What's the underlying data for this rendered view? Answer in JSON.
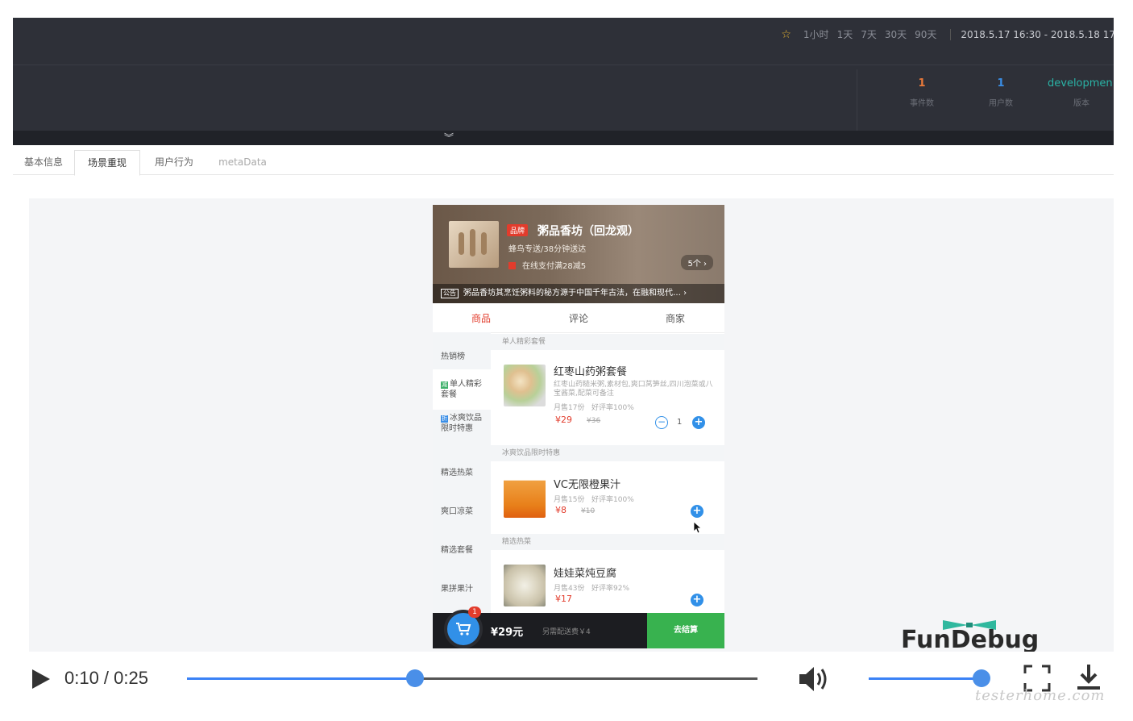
{
  "dashboard": {
    "time_ranges": [
      "1小时",
      "1天",
      "7天",
      "30天",
      "90天"
    ],
    "date_range": "2018.5.17 16:30 - 2018.5.18 17",
    "stats": [
      {
        "value": "1",
        "label": "事件数",
        "color": "#e8793a"
      },
      {
        "value": "1",
        "label": "用户数",
        "color": "#3a8ee6"
      },
      {
        "value": "developmen",
        "label": "版本",
        "color": "#2ab3a6"
      }
    ]
  },
  "tabs": [
    "基本信息",
    "场景重现",
    "用户行为",
    "metaData"
  ],
  "shop": {
    "brand_tag": "品牌",
    "name": "粥品香坊（回龙观）",
    "delivery": "蜂鸟专送/38分钟送达",
    "promo": "在线支付满28减5",
    "promo_count": "5个 ›",
    "notice_label": "公告",
    "notice": "粥品香坊其烹饪粥料的秘方源于中国千年古法，在融和现代… ›",
    "tabs": [
      "商品",
      "评论",
      "商家"
    ],
    "menu": [
      {
        "label": "热销榜",
        "icon": ""
      },
      {
        "label": "单人精彩套餐",
        "icon": "减"
      },
      {
        "label": "冰爽饮品限时特惠",
        "icon": "折"
      },
      {
        "label": "精选热菜",
        "icon": ""
      },
      {
        "label": "爽口凉菜",
        "icon": ""
      },
      {
        "label": "精选套餐",
        "icon": ""
      },
      {
        "label": "果拼果汁",
        "icon": ""
      }
    ],
    "sections": [
      "单人精彩套餐",
      "冰爽饮品限时特惠",
      "精选热菜"
    ],
    "foods": [
      {
        "name": "红枣山药粥套餐",
        "desc": "红枣山药糙米粥,素材包,爽口莴笋丝,四川泡菜或八宝酱菜,配菜可备注",
        "sold": "月售17份",
        "rating": "好评率100%",
        "price": "¥29",
        "old_price": "¥36",
        "qty": "1"
      },
      {
        "name": "VC无限橙果汁",
        "desc": "",
        "sold": "月售15份",
        "rating": "好评率100%",
        "price": "¥8",
        "old_price": "¥10",
        "qty": ""
      },
      {
        "name": "娃娃菜炖豆腐",
        "desc": "",
        "sold": "月售43份",
        "rating": "好评率92%",
        "price": "¥17",
        "old_price": "",
        "qty": ""
      }
    ],
    "cart": {
      "badge": "1",
      "total": "¥29元",
      "fee": "另需配送费￥4",
      "checkout": "去结算"
    }
  },
  "logo": "FunDebug",
  "player": {
    "time": "0:10 / 0:25",
    "progress": 0.4,
    "volume": 1.0
  },
  "watermark": "testerhome.com",
  "colors": {
    "accent": "#3190e8",
    "dash_bg": "#2e3038",
    "red": "#e23c2c",
    "green": "#38b24f"
  }
}
